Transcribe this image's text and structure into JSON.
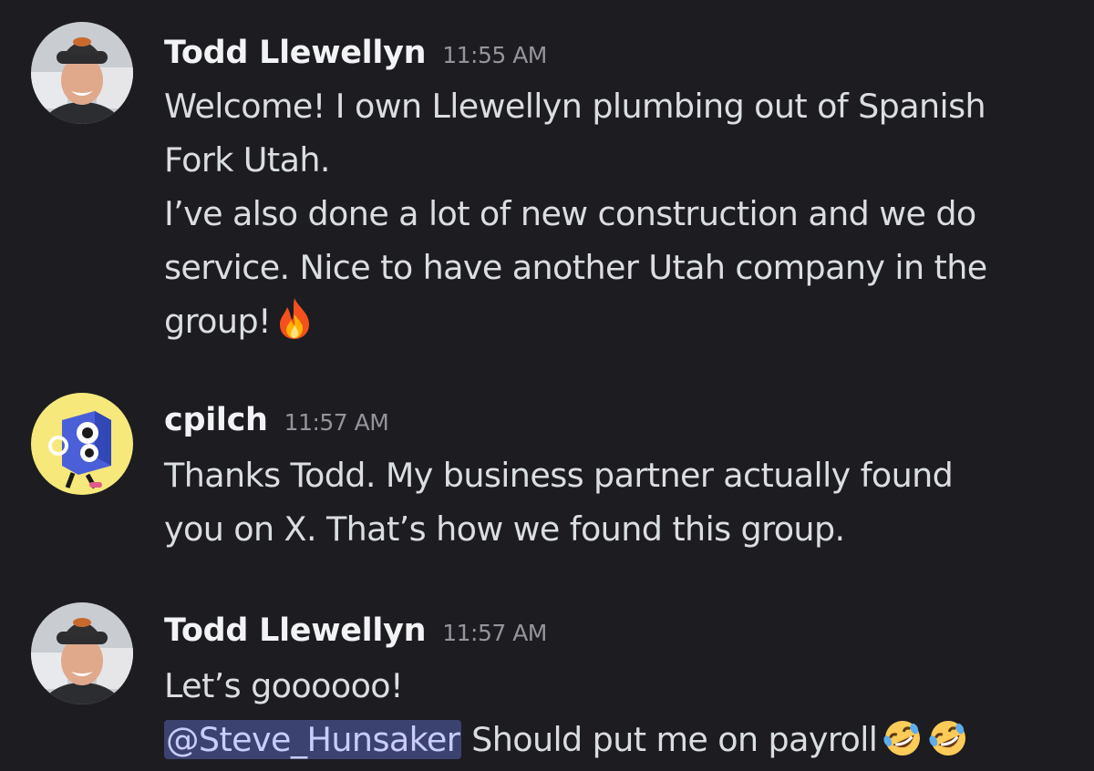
{
  "messages": [
    {
      "author": "Todd Llewellyn",
      "time": "11:55 AM",
      "lines": [
        "Welcome! I own Llewellyn plumbing out of Spanish",
        "Fork Utah.",
        "I’ve also done a lot of new construction and we do",
        "service. Nice to have another Utah company in the",
        "group!"
      ],
      "emoji": [
        "fire-emoji"
      ]
    },
    {
      "author": "cpilch",
      "time": "11:57 AM",
      "lines": [
        "Thanks Todd.  My business partner actually found",
        "you on X.  That’s how we found this group."
      ]
    },
    {
      "author": "Todd Llewellyn",
      "time": "11:57 AM",
      "lines": [
        "Let’s goooooo!"
      ],
      "mention": "@Steve_Hunsaker",
      "mention_text": " Should put me on payroll",
      "emoji": [
        "rofl-emoji",
        "rofl-emoji"
      ]
    }
  ],
  "colors": {
    "background": "#1c1c21",
    "username": "#f2f3f5",
    "timestamp": "#94959c",
    "text": "#dbdee1",
    "mention_bg": "#3c4270",
    "mention_text": "#c9cdfb"
  }
}
